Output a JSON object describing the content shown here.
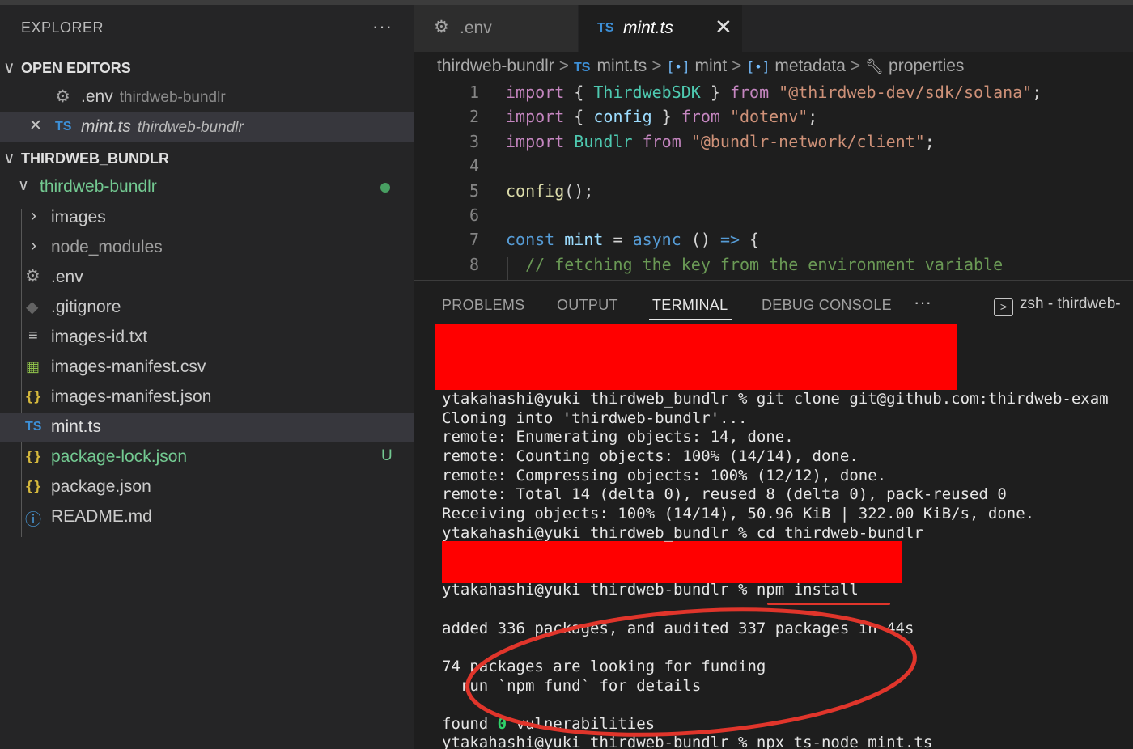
{
  "sidebar": {
    "title": "EXPLORER",
    "more": "···",
    "open_editors": {
      "label": "OPEN EDITORS",
      "items": [
        {
          "name": ".env",
          "desc": "thirdweb-bundlr"
        },
        {
          "name": "mint.ts",
          "desc": "thirdweb-bundlr",
          "icon": "TS",
          "close": "✕"
        }
      ]
    },
    "workspace": {
      "label": "THIRDWEB_BUNDLR",
      "folder": "thirdweb-bundlr",
      "items": [
        {
          "name": "images"
        },
        {
          "name": "node_modules"
        },
        {
          "name": ".env"
        },
        {
          "name": ".gitignore"
        },
        {
          "name": "images-id.txt"
        },
        {
          "name": "images-manifest.csv"
        },
        {
          "name": "images-manifest.json",
          "icon": "{}"
        },
        {
          "name": "mint.ts",
          "icon": "TS"
        },
        {
          "name": "package-lock.json",
          "icon": "{}",
          "badge": "U"
        },
        {
          "name": "package.json",
          "icon": "{}"
        },
        {
          "name": "README.md"
        }
      ]
    }
  },
  "tabs": [
    {
      "label": ".env"
    },
    {
      "label": "mint.ts",
      "icon": "TS",
      "close": "✕"
    }
  ],
  "breadcrumb": {
    "folder": "thirdweb-bundlr",
    "file": "mint.ts",
    "file_icon": "TS",
    "symbol1": "mint",
    "symbol2": "metadata",
    "symbol_icon": "[•]",
    "symbol3": "properties",
    "sep": ">"
  },
  "code": [
    {
      "n": "1",
      "parts": [
        [
          "kw",
          "import"
        ],
        [
          "pl",
          " { "
        ],
        [
          "ty",
          "ThirdwebSDK"
        ],
        [
          "pl",
          " } "
        ],
        [
          "kw",
          "from"
        ],
        [
          "pl",
          " "
        ],
        [
          "st",
          "\"@thirdweb-dev/sdk/solana\""
        ],
        [
          "pl",
          ";"
        ]
      ]
    },
    {
      "n": "2",
      "parts": [
        [
          "kw",
          "import"
        ],
        [
          "pl",
          " { "
        ],
        [
          "vr",
          "config"
        ],
        [
          "pl",
          " } "
        ],
        [
          "kw",
          "from"
        ],
        [
          "pl",
          " "
        ],
        [
          "st",
          "\"dotenv\""
        ],
        [
          "pl",
          ";"
        ]
      ]
    },
    {
      "n": "3",
      "parts": [
        [
          "kw",
          "import"
        ],
        [
          "pl",
          " "
        ],
        [
          "ty",
          "Bundlr"
        ],
        [
          "pl",
          " "
        ],
        [
          "kw",
          "from"
        ],
        [
          "pl",
          " "
        ],
        [
          "st",
          "\"@bundlr-network/client\""
        ],
        [
          "pl",
          ";"
        ]
      ]
    },
    {
      "n": "4",
      "parts": []
    },
    {
      "n": "5",
      "parts": [
        [
          "fn",
          "config"
        ],
        [
          "pl",
          "();"
        ]
      ]
    },
    {
      "n": "6",
      "parts": []
    },
    {
      "n": "7",
      "parts": [
        [
          "kb",
          "const"
        ],
        [
          "pl",
          " "
        ],
        [
          "vr",
          "mint"
        ],
        [
          "pl",
          " = "
        ],
        [
          "kb",
          "async"
        ],
        [
          "pl",
          " () "
        ],
        [
          "kb",
          "=>"
        ],
        [
          "pl",
          " {"
        ]
      ]
    },
    {
      "n": "8",
      "parts": [
        [
          "pl",
          "  "
        ],
        [
          "cm",
          "// fetching the key from the environment variable"
        ]
      ]
    }
  ],
  "panel": {
    "tabs": [
      "PROBLEMS",
      "OUTPUT",
      "TERMINAL",
      "DEBUG CONSOLE"
    ],
    "more": "···",
    "terminal_name": "zsh - thirdweb-",
    "terminal_icon": ">"
  },
  "terminal": {
    "lines": [
      "ytakahashi@yuki thirdweb_bundlr % git clone git@github.com:thirdweb-exam",
      "Cloning into 'thirdweb-bundlr'...",
      "remote: Enumerating objects: 14, done.",
      "remote: Counting objects: 100% (14/14), done.",
      "remote: Compressing objects: 100% (12/12), done.",
      "remote: Total 14 (delta 0), reused 8 (delta 0), pack-reused 0",
      "Receiving objects: 100% (14/14), 50.96 KiB | 322.00 KiB/s, done.",
      "ytakahashi@yuki thirdweb_bundlr % cd thirdweb-bundlr"
    ],
    "npm_install": "ytakahashi@yuki thirdweb-bundlr % npm install",
    "added": "added 336 packages, and audited 337 packages in 44s",
    "funding1": "74 packages are looking for funding",
    "funding2": "  run `npm fund` for details",
    "found_prefix": "found ",
    "found_zero": "0",
    "found_suffix": " vulnerabilities",
    "last": "ytakahashi@yuki thirdweb-bundlr % npx ts-node mint.ts"
  },
  "colors": {
    "redaction": "#ff0000",
    "annotation": "#e0352b",
    "git_untracked": "#73c991",
    "ts_icon": "#3d8fd6",
    "json_icon": "#d7ba3d"
  }
}
